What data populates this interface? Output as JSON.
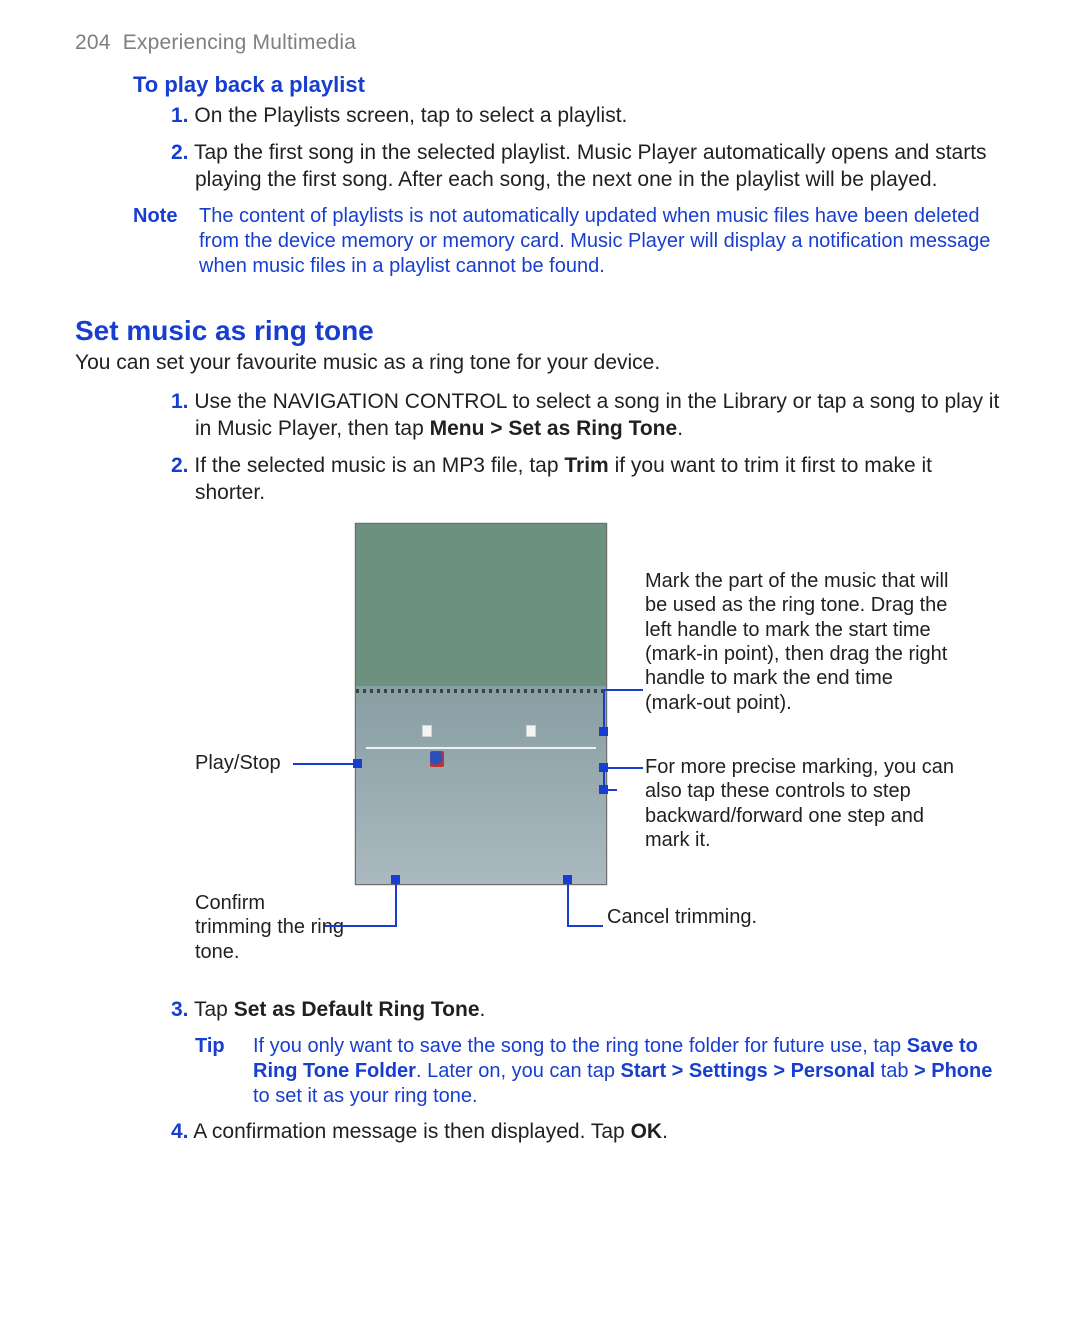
{
  "header": {
    "page_number": "204",
    "chapter": "Experiencing Multimedia"
  },
  "section1": {
    "heading": "To play back a playlist",
    "steps": {
      "s1_num": "1.",
      "s1_text": "On the Playlists screen, tap to select a playlist.",
      "s2_num": "2.",
      "s2_text": "Tap the first song in the selected playlist. Music Player automatically opens and starts playing the first song. After each song, the next one in the playlist will be played."
    },
    "note_label": "Note",
    "note_body": "The content of playlists is not automatically updated when music files have been deleted from the device memory or memory card. Music Player will display a notification message when music files in a playlist cannot be found."
  },
  "section2": {
    "heading": "Set music as ring tone",
    "intro": "You can set your favourite music as a ring tone for your device.",
    "steps": {
      "s1_num": "1.",
      "s1_a": "Use the NAVIGATION CONTROL to select a song in the Library or tap a song to play it in Music Player, then tap ",
      "s1_b": "Menu > Set as Ring Tone",
      "s1_c": ".",
      "s2_num": "2.",
      "s2_a": "If the selected music is an MP3 file, tap ",
      "s2_b": "Trim",
      "s2_c": " if you want to trim it first to make it shorter.",
      "s3_num": "3.",
      "s3_a": "Tap ",
      "s3_b": "Set as Default Ring Tone",
      "s3_c": ".",
      "s4_num": "4.",
      "s4_a": "A confirmation message is then displayed. Tap ",
      "s4_b": "OK",
      "s4_c": "."
    },
    "tip_label": "Tip",
    "tip": {
      "a": "If you only want to save the song to the ring tone folder for future use, tap ",
      "b": "Save to Ring Tone Folder",
      "c": ". Later on, you can tap ",
      "d": "Start > Settings > Personal",
      "e": " tab ",
      "f": "> Phone",
      "g": " to set it as your ring tone."
    },
    "callouts": {
      "playstop": "Play/Stop",
      "confirm": "Confirm trimming the ring tone.",
      "cancel": "Cancel trimming.",
      "mark": "Mark the part of the music that will be used as the ring tone. Drag the left handle to mark the start time (mark-in point), then drag the right handle to mark the end time (mark-out point).",
      "precise": "For more precise marking, you can also tap these controls to step backward/forward one step and mark it."
    }
  }
}
